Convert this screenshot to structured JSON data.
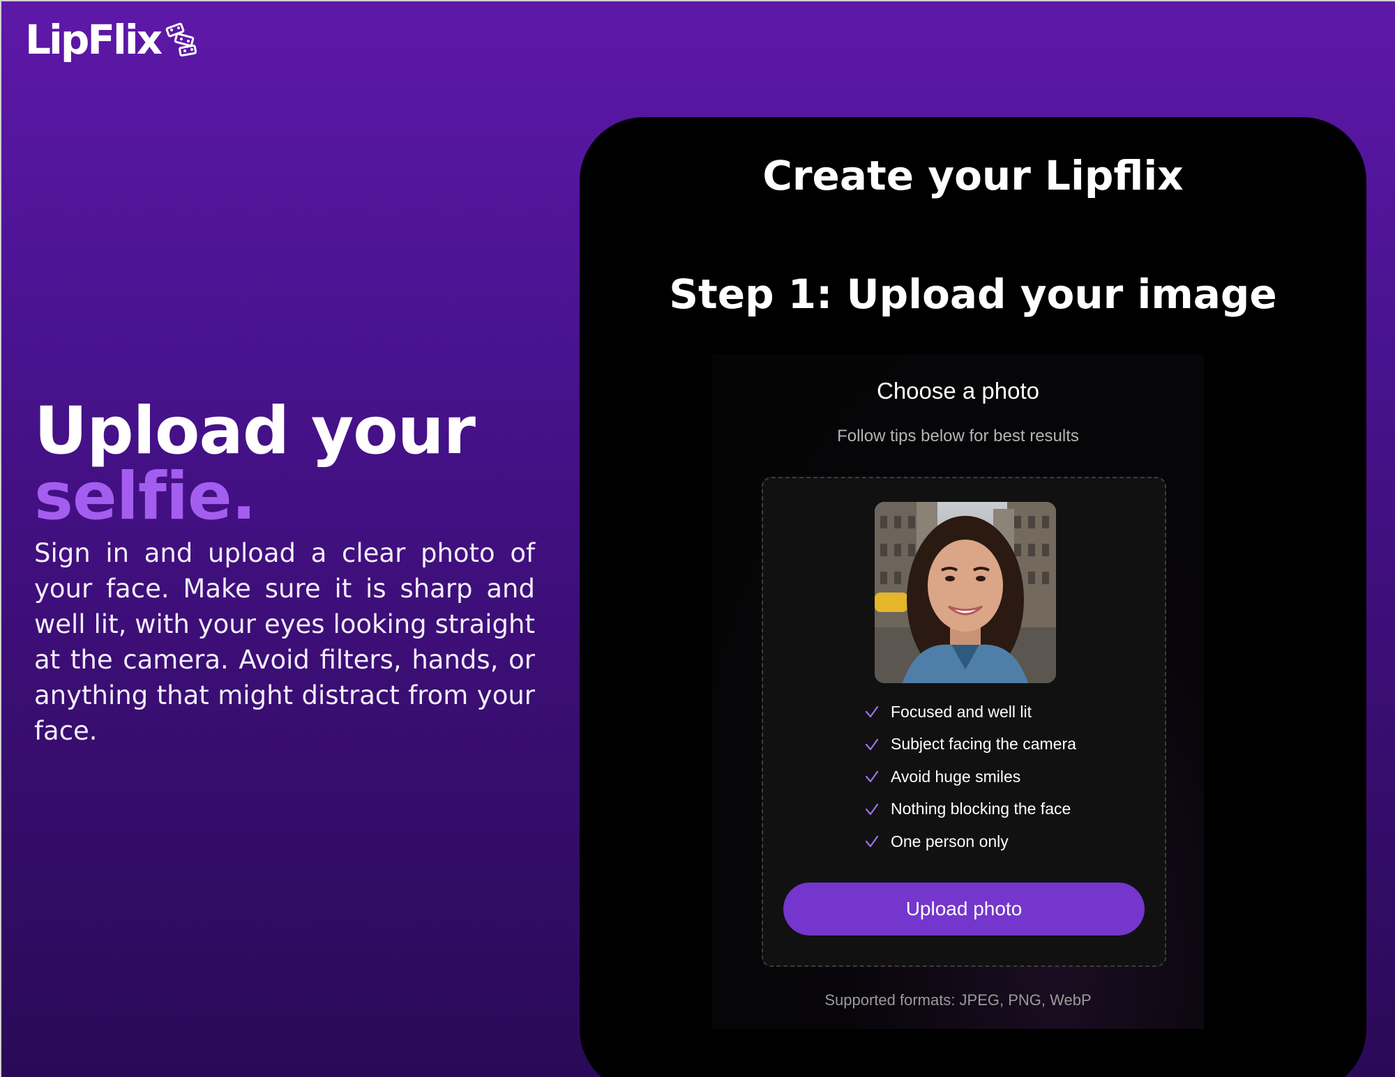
{
  "brand": {
    "logo_text": "LipFlix",
    "logo_icon": "film-reel-icon"
  },
  "hero": {
    "title_line1": "Upload your",
    "title_line2": "selfie.",
    "description": "Sign in and upload a clear photo of your face. Make sure it is sharp and well lit, with your eyes looking straight at the camera. Avoid filters, hands, or anything that might distract from your face."
  },
  "card": {
    "title": "Create your Lipflix",
    "step_title": "Step 1: Upload your image",
    "choose_label": "Choose a photo",
    "tips_subtitle": "Follow tips below for best results",
    "tips": [
      "Focused and well lit",
      "Subject facing the camera",
      "Avoid huge smiles",
      "Nothing blocking the face",
      "One person only"
    ],
    "upload_button": "Upload photo",
    "formats": "Supported formats: JPEG, PNG, WebP"
  },
  "colors": {
    "accent": "#7436cc",
    "highlight": "#a35ef0",
    "check": "#a070f0"
  }
}
